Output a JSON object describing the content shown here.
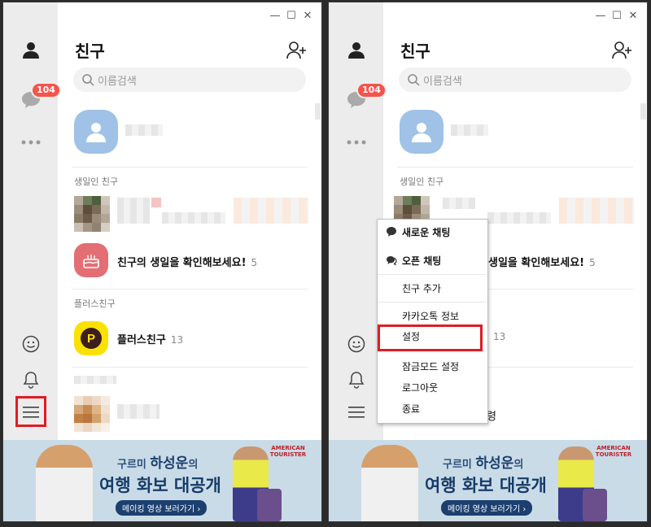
{
  "window_controls": {
    "minimize": "—",
    "maximize": "☐",
    "close": "✕"
  },
  "left": {
    "header_title": "친구",
    "search_placeholder": "이름검색",
    "chat_badge": "104",
    "birthday_section": "생일인 친구",
    "birthday_prompt": "친구의 생일을 확인해보세요!",
    "birthday_count": "5",
    "plus_section": "플러스친구",
    "plus_name": "플러스친구",
    "plus_count": "13",
    "plus_logo": "P"
  },
  "right": {
    "header_title": "친구",
    "search_placeholder": "이름검색",
    "chat_badge": "104",
    "birthday_section": "생일인 친구",
    "birthday_prompt_partial": "생일을 확인해보세요!",
    "birthday_count": "5",
    "plus_count_partial": "13",
    "partial_name": "령"
  },
  "menu": {
    "items": [
      {
        "label": "새로운 채팅",
        "icon": "chat-bubble-icon"
      },
      {
        "label": "오픈 채팅",
        "icon": "open-chat-icon"
      },
      {
        "label": "친구 추가"
      },
      {
        "label": "카카오톡 정보"
      },
      {
        "label": "설정"
      },
      {
        "label": "잠금모드 설정"
      },
      {
        "label": "로그아웃"
      },
      {
        "label": "종료"
      }
    ]
  },
  "banner": {
    "line1_prefix": "구르미 ",
    "line1_highlight": "하성운",
    "line1_suffix": "의",
    "line2": "여행 화보 대공개",
    "button": "메이킹 영상 보러가기 ›",
    "brand": "AMERICAN TOURISTER"
  },
  "colors": {
    "highlight": "#e01b24",
    "badge": "#f5534b",
    "plus_yellow": "#fae100"
  }
}
